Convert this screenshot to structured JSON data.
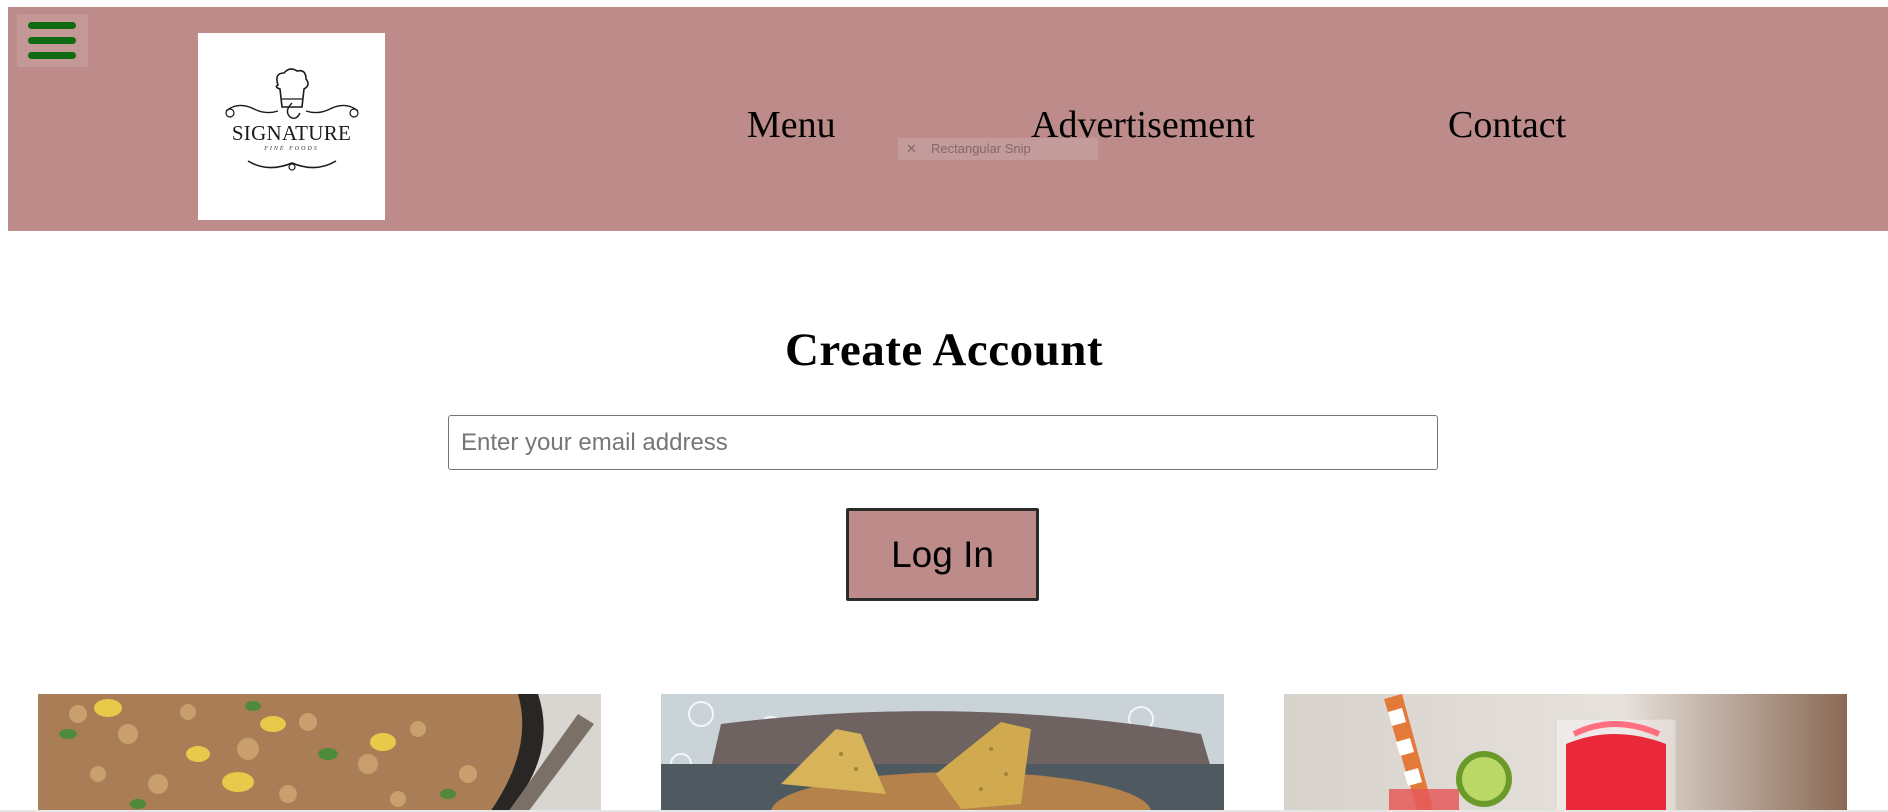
{
  "header": {
    "menu_toggle_icon": "hamburger-icon",
    "logo": {
      "wordmark": "SIGNATURE",
      "tagline": "FINE FOODS",
      "icon": "chef-hat-icon"
    },
    "nav": [
      {
        "label": "Menu"
      },
      {
        "label": "Advertisement"
      },
      {
        "label": "Contact"
      }
    ],
    "snip_overlay": {
      "close_icon": "close-icon",
      "label": "Rectangular Snip"
    },
    "colors": {
      "background": "#bc8b8a",
      "hamburger": "#0f6a12"
    }
  },
  "form": {
    "title": "Create Account",
    "email_placeholder": "Enter your email address",
    "email_value": "",
    "submit_label": "Log In"
  },
  "gallery": [
    {
      "image": "fried-rice-photo"
    },
    {
      "image": "cornbread-slices-photo"
    },
    {
      "image": "strawberry-drinks-photo"
    }
  ]
}
